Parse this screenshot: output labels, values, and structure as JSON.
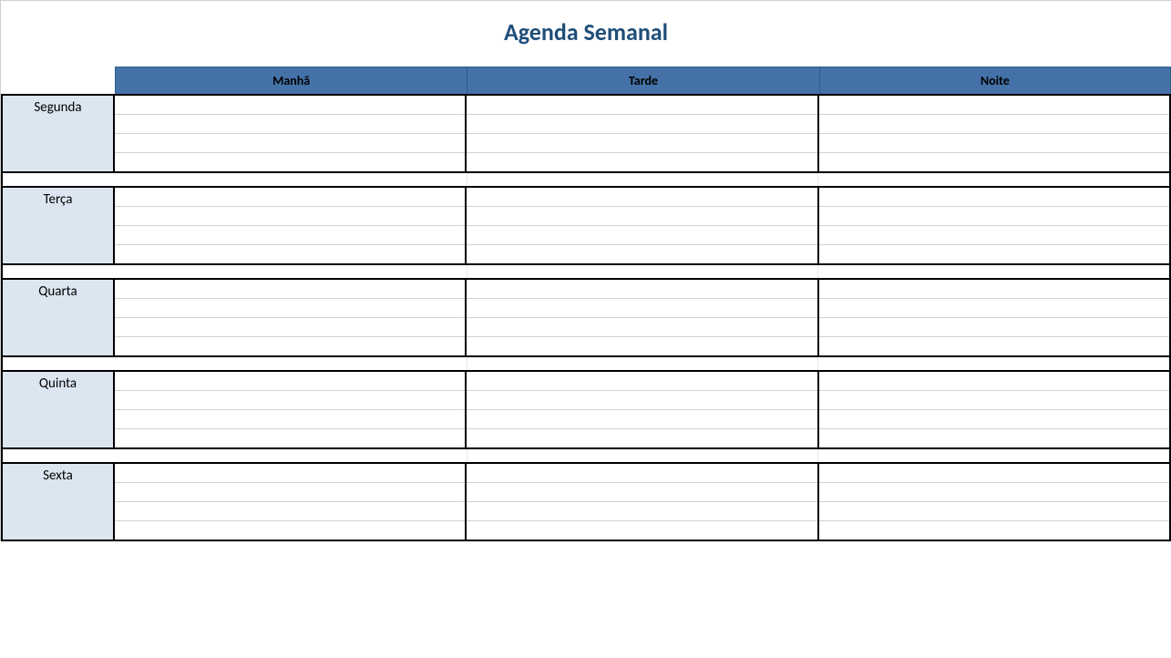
{
  "title": "Agenda Semanal",
  "periods": [
    {
      "label": "Manhã"
    },
    {
      "label": "Tarde"
    },
    {
      "label": "Noite"
    }
  ],
  "days": [
    {
      "label": "Segunda"
    },
    {
      "label": "Terça"
    },
    {
      "label": "Quarta"
    },
    {
      "label": "Quinta"
    },
    {
      "label": "Sexta"
    }
  ],
  "slots_per_cell": 4
}
